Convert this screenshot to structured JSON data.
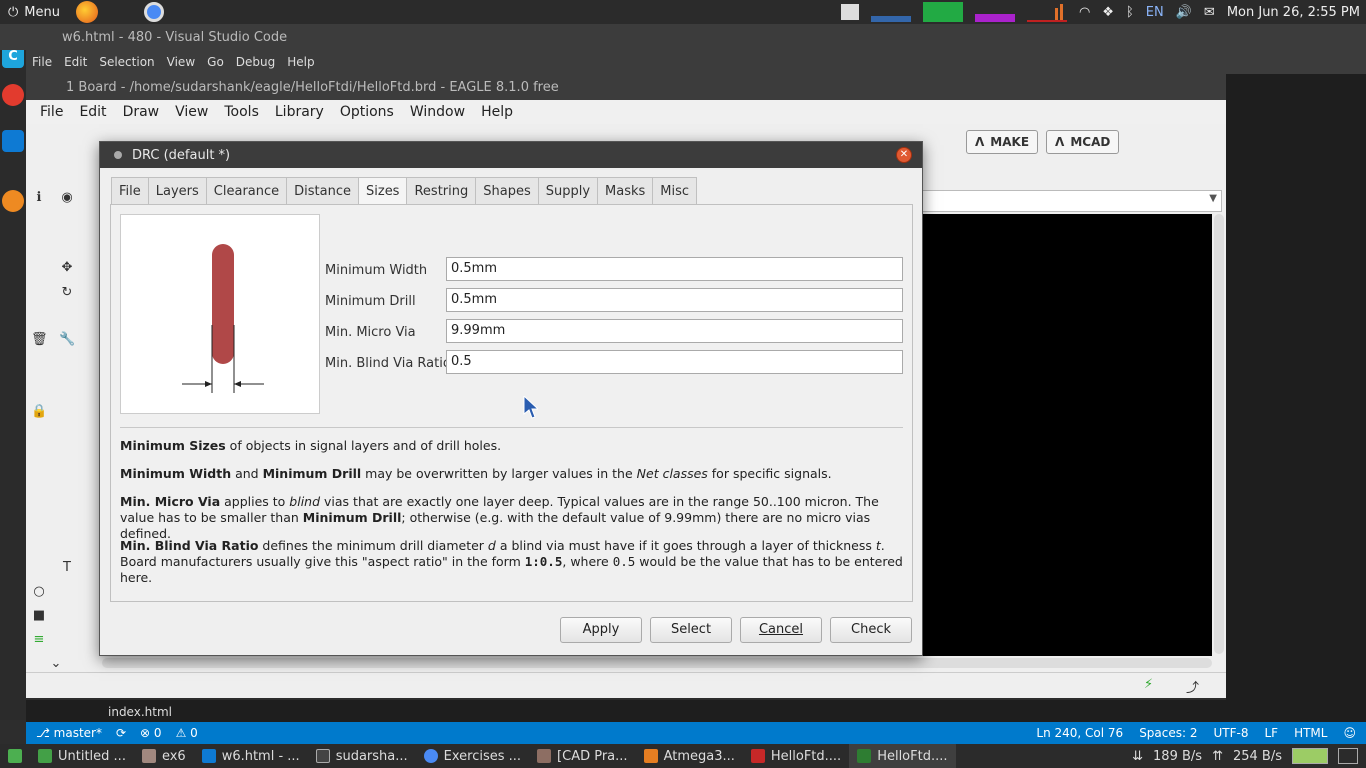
{
  "system": {
    "menu_label": "Menu",
    "language": "EN",
    "datetime": "Mon Jun 26,  2:55 PM"
  },
  "vscode": {
    "title": "w6.html - 480 - Visual Studio Code",
    "menu": [
      "File",
      "Edit",
      "Selection",
      "View",
      "Go",
      "Debug",
      "Help"
    ],
    "explorer_item": "index.html",
    "status_left": [
      "master*",
      "0",
      "0"
    ],
    "status_right": [
      "Ln 240, Col 76",
      "Spaces: 2",
      "UTF-8",
      "LF",
      "HTML"
    ]
  },
  "eagle": {
    "title": "1 Board - /home/sudarshank/eagle/HelloFtdi/HelloFtd.brd - EAGLE 8.1.0 free",
    "menu": [
      "File",
      "Edit",
      "Draw",
      "View",
      "Tools",
      "Library",
      "Options",
      "Window",
      "Help"
    ],
    "make_label": "MAKE",
    "mcad_label": "MCAD"
  },
  "drc": {
    "title": "DRC (default *)",
    "tabs": [
      "File",
      "Layers",
      "Clearance",
      "Distance",
      "Sizes",
      "Restring",
      "Shapes",
      "Supply",
      "Masks",
      "Misc"
    ],
    "active_tab": "Sizes",
    "fields": [
      {
        "label": "Minimum Width",
        "value": "0.5mm"
      },
      {
        "label": "Minimum Drill",
        "value": "0.5mm"
      },
      {
        "label": "Min. Micro Via",
        "value": "9.99mm"
      },
      {
        "label": "Min. Blind Via Ratio",
        "value": "0.5"
      }
    ],
    "help": {
      "p1_bold": "Minimum Sizes",
      "p1_rest": " of objects in signal layers and of drill holes.",
      "p2_b1": "Minimum Width",
      "p2_t1": " and ",
      "p2_b2": "Minimum Drill",
      "p2_t2": " may be overwritten by larger values in the ",
      "p2_i": "Net classes",
      "p2_t3": " for specific signals.",
      "p3_b1": "Min. Micro Via",
      "p3_t1": " applies to ",
      "p3_i": "blind",
      "p3_t2": " vias that are exactly one layer deep. Typical values are in the range 50..100 micron. The value has to be smaller than ",
      "p3_b2": "Minimum Drill",
      "p3_t3": "; otherwise (e.g. with the default value of 9.99mm) there are no micro vias defined.",
      "p4_b1": "Min. Blind Via Ratio",
      "p4_t1": " defines the minimum drill diameter ",
      "p4_i1": "d",
      "p4_t2": " a blind via must have if it goes through a layer of thickness ",
      "p4_i2": "t",
      "p4_t3": ". Board manufacturers usually give this \"aspect ratio\" in the form ",
      "p4_m1": "1:0.5",
      "p4_t4": ", where ",
      "p4_m2": "0.5",
      "p4_t5": " would be the value that has to be entered here."
    },
    "buttons": {
      "apply": "Apply",
      "select": "Select",
      "cancel": "Cancel",
      "check": "Check"
    }
  },
  "taskbar": {
    "tasks": [
      "Untitled ...",
      "ex6",
      "w6.html - ...",
      "sudarsha...",
      "Exercises ...",
      "[CAD Pra...",
      "Atmega3...",
      "HelloFtd....",
      "HelloFtd...."
    ],
    "net_down": "189 B/s",
    "net_up": "254 B/s"
  },
  "colors": {
    "vscode_blue": "#007acc",
    "trace_red": "#b04848",
    "dialog_bg": "#efefef"
  }
}
